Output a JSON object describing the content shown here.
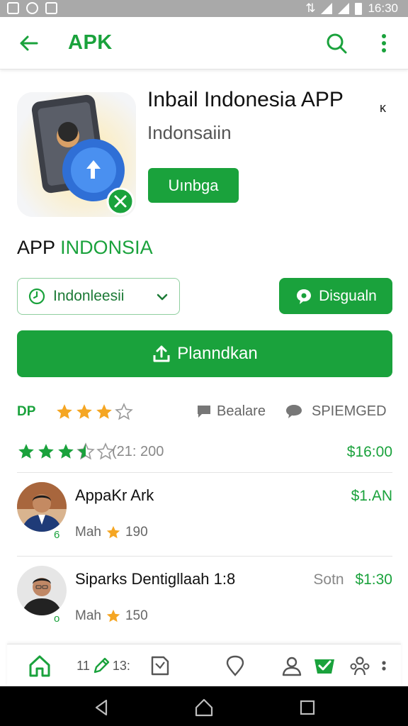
{
  "status_bar": {
    "time": "16:30"
  },
  "app_bar": {
    "title": "APK"
  },
  "app": {
    "name": "Inbail Indonesia APP",
    "close_mark": "κ",
    "subtitle": "Indonsaiin",
    "install_label": "Uınbga"
  },
  "section": {
    "title_part1": "APP",
    "title_part2": "INDONSIA"
  },
  "language_select": {
    "value": "Indonleesii"
  },
  "download_button": {
    "label": "Disgualn"
  },
  "primary_button": {
    "label": "Planndkan"
  },
  "rating_row": {
    "prefix": "DP",
    "stars_filled": 3,
    "stars_total": 4,
    "share_label": "Bealare",
    "tag_label": "SPIEMGED"
  },
  "summary_row": {
    "stars": 3.5,
    "count": "(21: 200",
    "price": "$16:00"
  },
  "reviews": [
    {
      "name": "AppaKr Ark",
      "price": "$1.AN",
      "meta_label": "Mah",
      "meta_value": "190",
      "badge": "6"
    },
    {
      "name": "Siparks Dentigllaah   1:8",
      "price_old": "Sotn",
      "price": "$1:30",
      "meta_label": "Mah",
      "meta_value": "150",
      "badge": "o"
    }
  ],
  "bottom_nav": {
    "item2_prefix": "11",
    "item2_suffix": "13:"
  },
  "colors": {
    "brand": "#1aa23c",
    "star": "#f5a623",
    "status_bar": "#a9a9a9"
  }
}
